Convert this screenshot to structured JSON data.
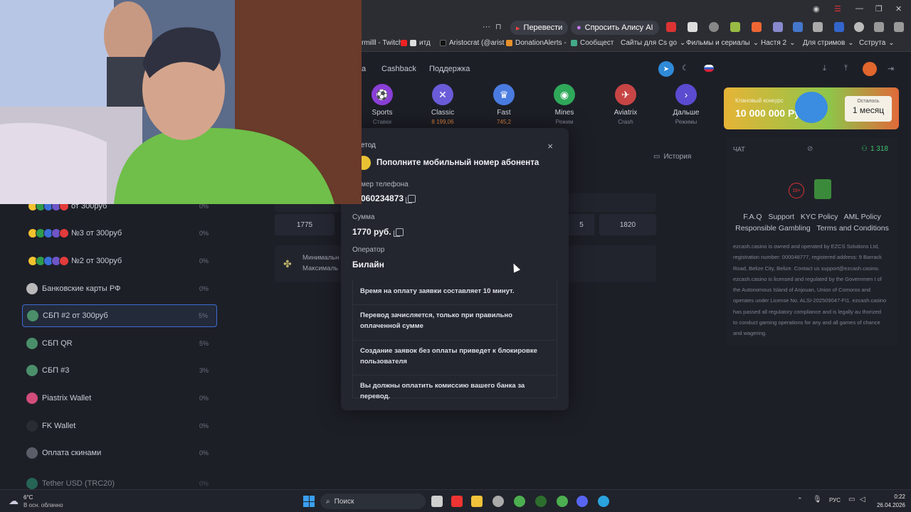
{
  "browser": {
    "toolbar": {
      "translate_label": "Перевести",
      "alice_label": "Спросить Алису AI"
    },
    "bookmarks": [
      "rmilll - Twitch",
      "итд",
      "Aristocrat (@arist",
      "DonationAlerts - ",
      "Сообщест",
      "Сайты для Cs go",
      "Фильмы и сериалы",
      "Настя 2",
      "Для стримов",
      "Сструта"
    ]
  },
  "site": {
    "nav": [
      "а",
      "Cashback",
      "Поддержка"
    ],
    "games": [
      {
        "name": "Sports",
        "sub": "Ставки",
        "color": "#8a3fd6",
        "icon": "⚽"
      },
      {
        "name": "Classic",
        "sub": "8 199,06",
        "color": "#6a5cd8",
        "icon": "✕"
      },
      {
        "name": "Fast",
        "sub": "745,2",
        "color": "#4a7be0",
        "icon": "♛"
      },
      {
        "name": "Mines",
        "sub": "Режим",
        "color": "#2fa85a",
        "icon": "◉"
      },
      {
        "name": "Aviatrix",
        "sub": "Crash",
        "color": "#c84545",
        "icon": "✈"
      },
      {
        "name": "Дальше",
        "sub": "Режимы",
        "color": "#5a4bd0",
        "icon": "›"
      }
    ],
    "banner": {
      "title": "Клановый конкурс",
      "amount": "10 000 000 Руб",
      "left_label": "Осталось",
      "left_value": "1 месяц"
    },
    "history_label": "История",
    "amounts": [
      "1775",
      "5",
      "1820"
    ],
    "minimal_label": "Минимальн",
    "maximal_label": "Максималь",
    "payment_methods": [
      {
        "label": "от 300руб",
        "pct": "0%",
        "type": "multi"
      },
      {
        "label": "№3 от 300руб",
        "pct": "0%",
        "type": "multi"
      },
      {
        "label": "№2 от 300руб",
        "pct": "0%",
        "type": "multi"
      },
      {
        "label": "Банковские карты РФ",
        "pct": "0%",
        "type": "card"
      },
      {
        "label": "СБП #2 от 300руб",
        "pct": "5%",
        "type": "sbp",
        "selected": true
      },
      {
        "label": "СБП QR",
        "pct": "5%",
        "type": "sbp"
      },
      {
        "label": "СБП #3",
        "pct": "3%",
        "type": "sbp"
      },
      {
        "label": "Piastrix Wallet",
        "pct": "0%",
        "type": "piastrix"
      },
      {
        "label": "FK Wallet",
        "pct": "0%",
        "type": "fk"
      },
      {
        "label": "Оплата скинами",
        "pct": "0%",
        "type": "steam"
      },
      {
        "label": "Tether USD (TRC20)",
        "pct": "0%",
        "type": "tether"
      }
    ],
    "chat": {
      "label": "ЧАТ",
      "online": "1 318"
    },
    "right_panel": {
      "age": "18+",
      "links": [
        "F.A.Q",
        "Support",
        "KYC Policy",
        "AML Policy",
        "Responsible Gambling",
        "Terms and Conditions"
      ],
      "legal": [
        "ezcash.casino is owned and operated by EZCS Solutions Ltd,",
        "registration number: 000048777, registered address: 9 Barrack",
        "Road, Belize City, Belize. Contact us support@ezcash.casino.",
        "ezcash.casino is licensed and regulated by the Governmen t of",
        "the Autonomous Island of Anjouan, Union of Comoros and",
        "operates under License No. ALSI-202509047-FI1. ezcash.casino",
        "has passed all regulatory compliance and is legally au thorized",
        "to conduct gaming operations for any and all games of chance",
        "and wagering."
      ]
    }
  },
  "modal": {
    "method_label": "етод",
    "method_title": "Пополните мобильный номер абонента",
    "phone_label": "мер телефона",
    "phone_value": "060234873",
    "sum_label": "Сумма",
    "sum_value": "1770 руб.",
    "operator_label": "Оператор",
    "operator_value": "Билайн",
    "notes": [
      "Время на оплату заявки составляет 10 минут.",
      "Перевод зачисляется, только при правильно оплаченной сумме",
      "Создание заявок без оплаты приведет к блокировке пользователя",
      "Вы должны оплатить комиссию вашего банка за перевод."
    ]
  },
  "taskbar": {
    "weather_temp": "6°C",
    "weather_text": "В осн. облачно",
    "search_label": "Поиск",
    "lang": "РУС",
    "time": "0:22",
    "date": "26.04.2026"
  }
}
